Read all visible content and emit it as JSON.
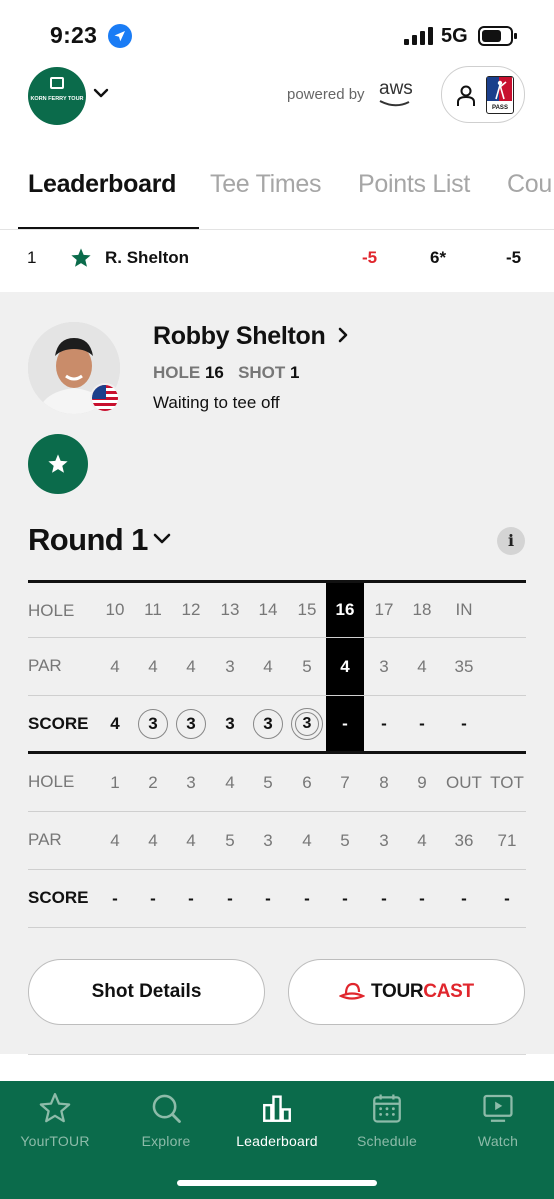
{
  "status_bar": {
    "time": "9:23",
    "network": "5G"
  },
  "header": {
    "logo_text": "KORN FERRY TOUR",
    "powered_by": "powered by",
    "sponsor": "aws",
    "pass_label": "PASS"
  },
  "tabs": [
    {
      "label": "Leaderboard",
      "active": true
    },
    {
      "label": "Tee Times",
      "active": false
    },
    {
      "label": "Points List",
      "active": false
    },
    {
      "label": "Cou",
      "active": false
    }
  ],
  "player_row": {
    "position": "1",
    "name": "R. Shelton",
    "to_par": "-5",
    "thru": "6*",
    "total": "-5"
  },
  "player": {
    "name": "Robby Shelton",
    "hole_label": "HOLE",
    "hole": "16",
    "shot_label": "SHOT",
    "shot": "1",
    "status": "Waiting to tee off"
  },
  "round": {
    "title": "Round 1",
    "info": "i"
  },
  "scorecard": {
    "back": {
      "hole_label": "HOLE",
      "par_label": "PAR",
      "score_label": "SCORE",
      "holes": [
        "10",
        "11",
        "12",
        "13",
        "14",
        "15",
        "16",
        "17",
        "18",
        "IN"
      ],
      "pars": [
        "4",
        "4",
        "4",
        "3",
        "4",
        "5",
        "4",
        "3",
        "4",
        "35"
      ],
      "scores": [
        "4",
        "3",
        "3",
        "3",
        "3",
        "3",
        "-",
        "-",
        "-",
        "-"
      ]
    },
    "front": {
      "hole_label": "HOLE",
      "par_label": "PAR",
      "score_label": "SCORE",
      "holes": [
        "1",
        "2",
        "3",
        "4",
        "5",
        "6",
        "7",
        "8",
        "9",
        "OUT",
        "TOT"
      ],
      "pars": [
        "4",
        "4",
        "4",
        "5",
        "3",
        "4",
        "5",
        "3",
        "4",
        "36",
        "71"
      ],
      "scores": [
        "-",
        "-",
        "-",
        "-",
        "-",
        "-",
        "-",
        "-",
        "-",
        "-",
        "-"
      ]
    }
  },
  "buttons": {
    "shot_details": "Shot Details",
    "tourcast_tour": "TOUR",
    "tourcast_cast": "CAST"
  },
  "bottom_nav": [
    {
      "label": "YourTOUR",
      "icon": "star-outline-icon",
      "active": false
    },
    {
      "label": "Explore",
      "icon": "search-icon",
      "active": false
    },
    {
      "label": "Leaderboard",
      "icon": "leaderboard-icon",
      "active": true
    },
    {
      "label": "Schedule",
      "icon": "calendar-icon",
      "active": false
    },
    {
      "label": "Watch",
      "icon": "tv-icon",
      "active": false
    }
  ],
  "colors": {
    "brand_green": "#0b6b4b",
    "under_par_red": "#e0262d",
    "tourcast_red": "#e0262d"
  }
}
